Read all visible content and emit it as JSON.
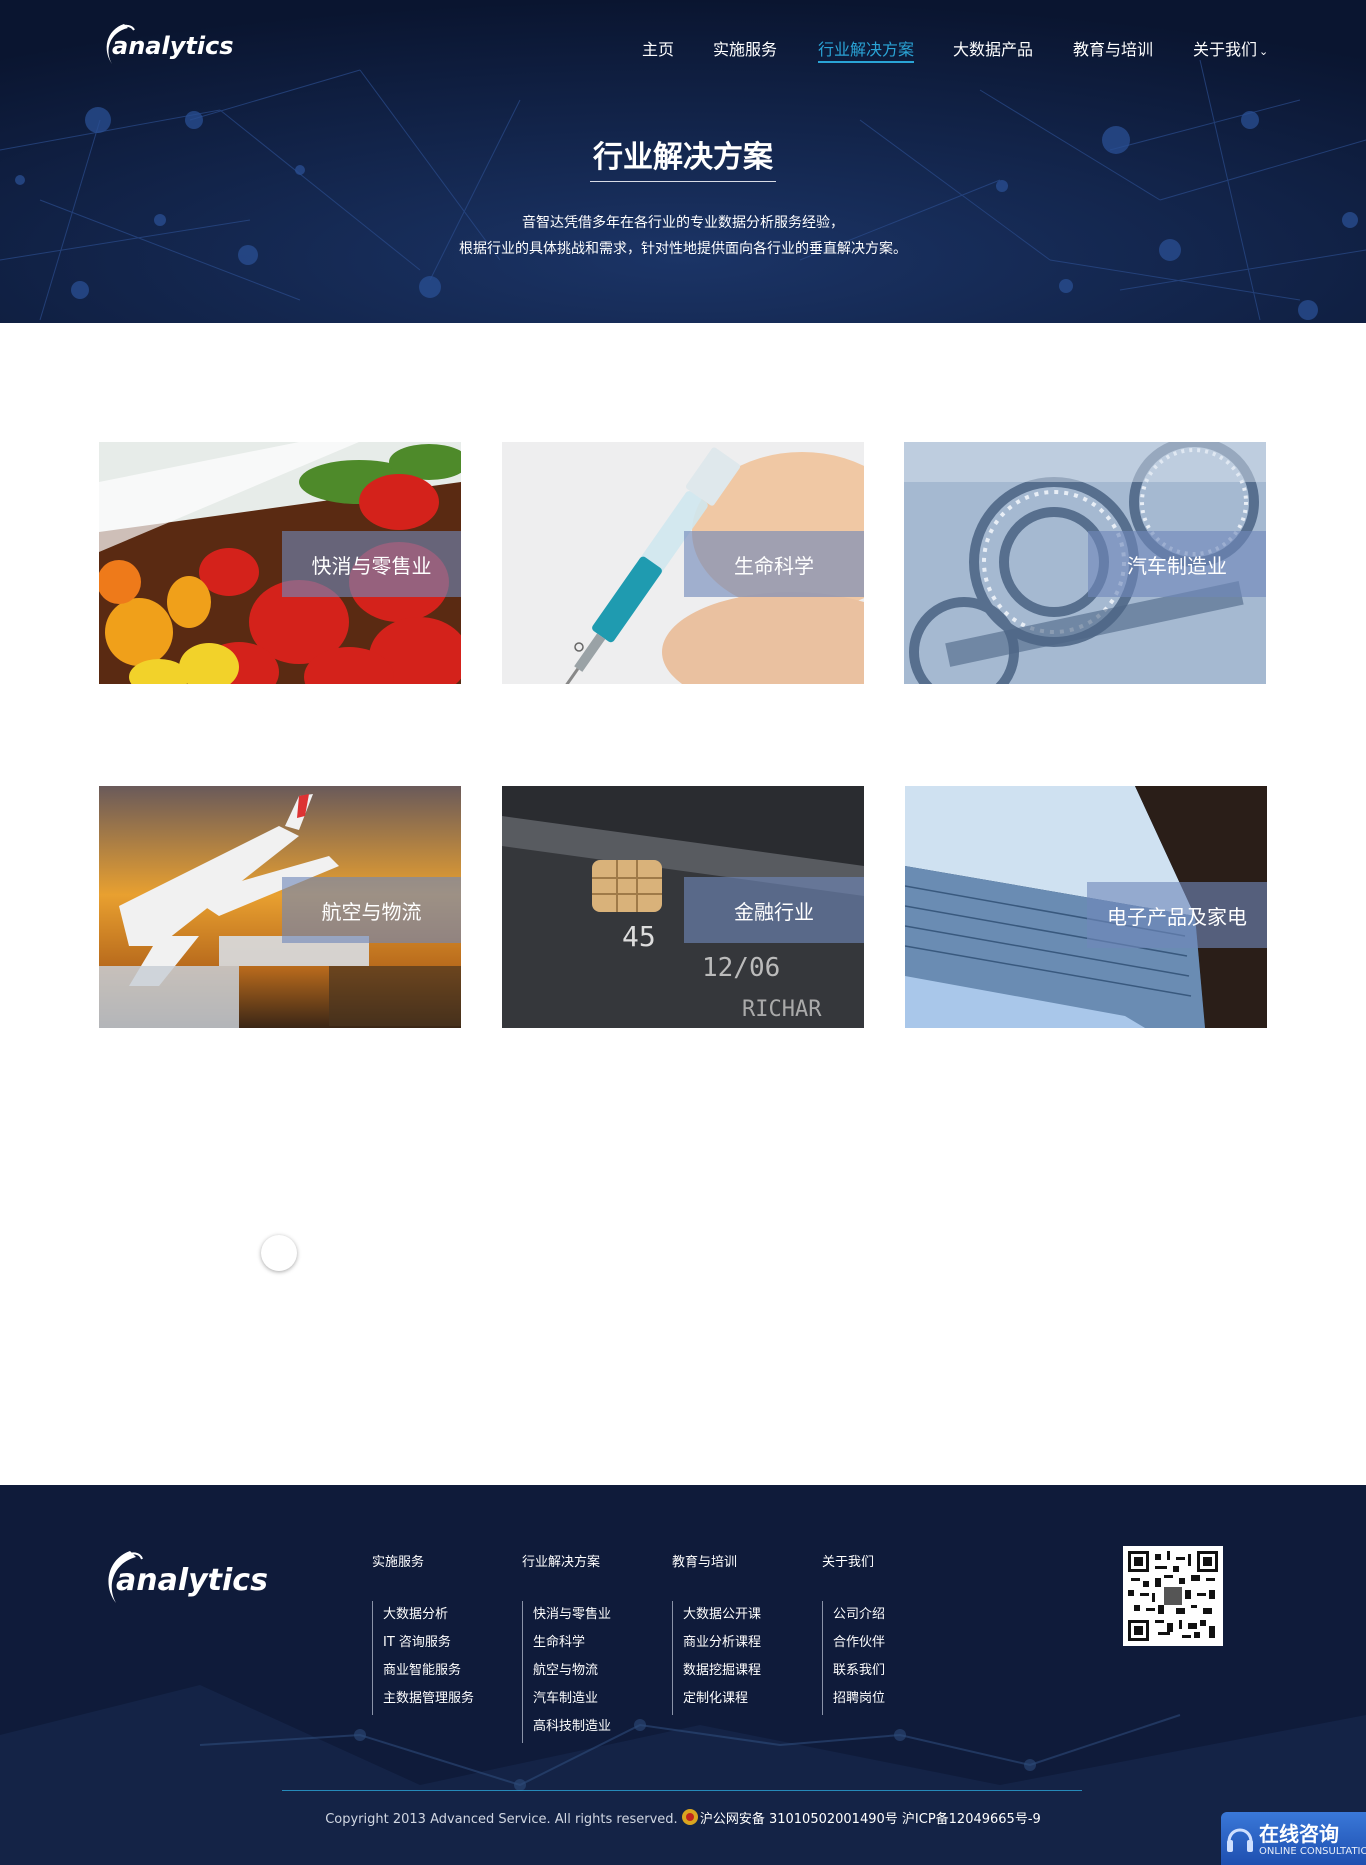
{
  "brand": {
    "logo_text": "analytics"
  },
  "nav": {
    "items": [
      {
        "label": "主页"
      },
      {
        "label": "实施服务"
      },
      {
        "label": "行业解决方案",
        "active": true
      },
      {
        "label": "大数据产品"
      },
      {
        "label": "教育与培训"
      },
      {
        "label": "关于我们",
        "has_dropdown": true,
        "dropdown_icon": "chevron-down-icon"
      }
    ]
  },
  "hero": {
    "title": "行业解决方案",
    "description_line1": "音智达凭借多年在各行业的专业数据分析服务经验，",
    "description_line2": "根据行业的具体挑战和需求，针对性地提供面向各行业的垂直解决方案。"
  },
  "industries": [
    {
      "label": "快消与零售业",
      "image": "red-bell-peppers-photo"
    },
    {
      "label": "生命科学",
      "image": "syringe-photo"
    },
    {
      "label": "汽车制造业",
      "image": "gears-photo"
    },
    {
      "label": "航空与物流",
      "image": "airplane-photo"
    },
    {
      "label": "金融行业",
      "image": "credit-card-photo"
    },
    {
      "label": "电子产品及家电",
      "image": "laptop-photo"
    }
  ],
  "footer": {
    "logo_text": "analytics",
    "columns": [
      {
        "title": "实施服务",
        "items": [
          "大数据分析",
          "IT 咨询服务",
          "商业智能服务",
          "主数据管理服务"
        ]
      },
      {
        "title": "行业解决方案",
        "items": [
          "快消与零售业",
          "生命科学",
          "航空与物流",
          "汽车制造业",
          "高科技制造业"
        ]
      },
      {
        "title": "教育与培训",
        "items": [
          "大数据公开课",
          "商业分析课程",
          "数据挖掘课程",
          "定制化课程"
        ]
      },
      {
        "title": "关于我们",
        "items": [
          "公司介绍",
          "合作伙伴",
          "联系我们",
          "招聘岗位"
        ]
      }
    ],
    "qr_icon": "qr-code-icon",
    "copyright": "Copyright 2013 Advanced Service. All rights reserved.",
    "police_record": "沪公网安备 31010502001490号",
    "icp_record": "沪ICP备12049665号-9"
  },
  "consult_widget": {
    "label": "在线咨询",
    "sublabel": "ONLINE CONSULTATION"
  },
  "colors": {
    "hero_bg": "#0a1530",
    "footer_bg": "#0f1b3a",
    "accent": "#2aa4d6",
    "card_label_bg": "rgba(112,136,186,0.62)"
  }
}
